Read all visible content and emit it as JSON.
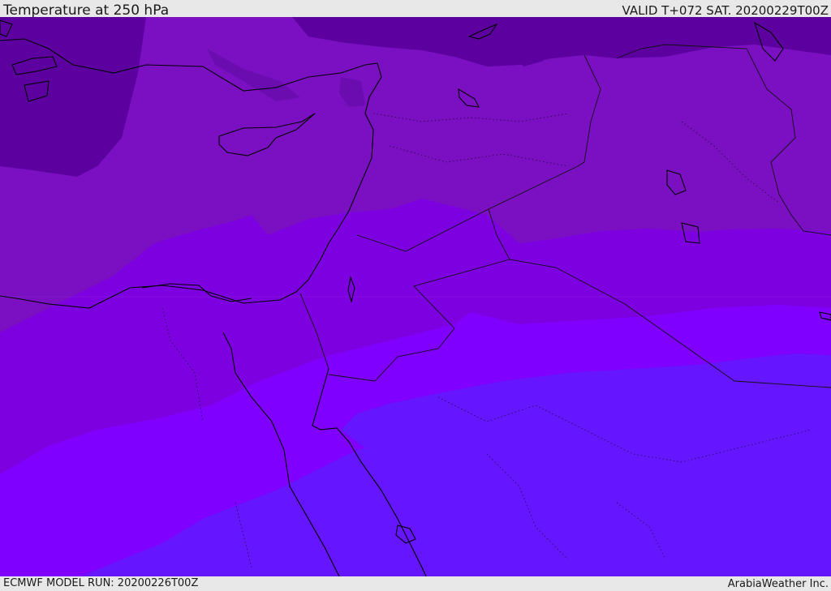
{
  "header": {
    "title": "Temperature at 250 hPa",
    "valid": "VALID T+072 SAT. 20200229T00Z"
  },
  "footer": {
    "model_run": "ECMWF MODEL RUN: 20200226T00Z",
    "credit": "ArabiaWeather Inc."
  },
  "map": {
    "field": "temperature",
    "level_hpa": 250,
    "colors": {
      "band_darkest": "#5c00a0",
      "band_dark": "#6c0fb6",
      "band_mid": "#7a10c2",
      "band_bright": "#7d00e0",
      "band_vivid": "#7f00ff",
      "band_blue": "#6615ff",
      "coastline": "#000000",
      "borders": "#111111"
    }
  }
}
